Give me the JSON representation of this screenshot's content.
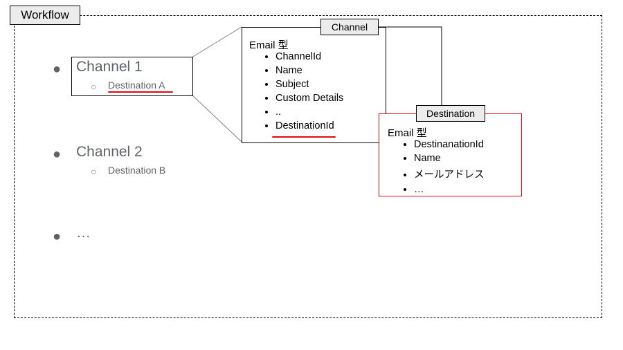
{
  "workflow": {
    "label": "Workflow"
  },
  "sidebar": {
    "channel1": {
      "title": "Channel 1",
      "destination": "Destination A"
    },
    "channel2": {
      "title": "Channel 2",
      "destination": "Destination B"
    },
    "more": "…"
  },
  "channelBox": {
    "label": "Channel",
    "heading": "Email 型",
    "fields": {
      "f0": "ChannelId",
      "f1": "Name",
      "f2": "Subject",
      "f3": "Custom Details",
      "f4": "..",
      "f5": "DestinationId"
    }
  },
  "destinationBox": {
    "label": "Destination",
    "heading": "Email 型",
    "fields": {
      "f0": "DestinanationId",
      "f1": "Name",
      "f2": "メールアドレス",
      "f3": "…"
    }
  }
}
